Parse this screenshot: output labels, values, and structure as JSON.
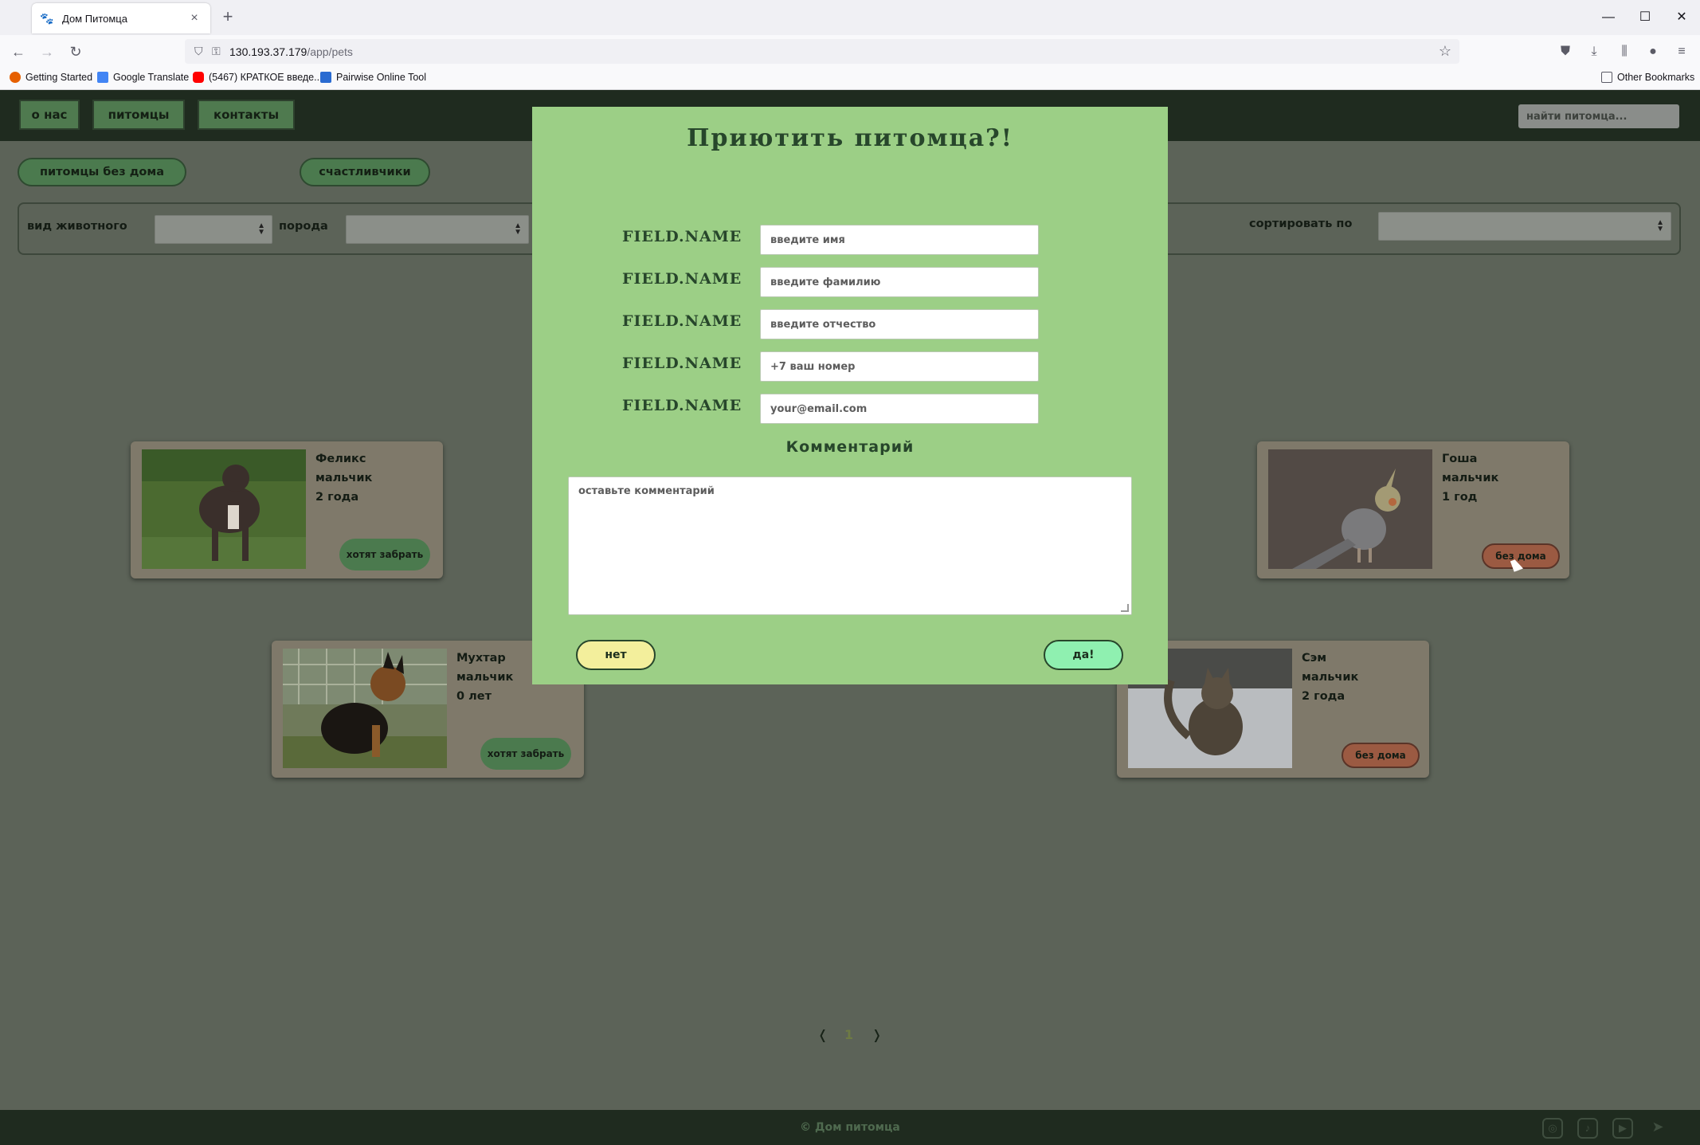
{
  "browser": {
    "tab_title": "Дом Питомца",
    "tab_close_icon": "×",
    "new_tab_icon": "+",
    "url_host": "130.193.37.179",
    "url_path": "/app/pets",
    "window_controls": {
      "minimize": "—",
      "maximize": "☐",
      "close": "✕"
    },
    "nav": {
      "back": "←",
      "forward": "→",
      "reload": "↻"
    },
    "bookmarks": [
      {
        "label": "Getting Started",
        "color": "#e66000"
      },
      {
        "label": "Google Translate",
        "color": "#4285f4"
      },
      {
        "label": "(5467) КРАТКОЕ введе...",
        "color": "#ff0000"
      },
      {
        "label": "Pairwise Online Tool",
        "color": "#2a6bd1"
      }
    ],
    "other_bookmarks": "Other Bookmarks"
  },
  "header": {
    "nav_items": [
      "о нас",
      "питомцы",
      "контакты"
    ],
    "search_placeholder": "найти питомца..."
  },
  "filters": {
    "tabs": [
      "питомцы без дома",
      "счастливчики"
    ],
    "species_label": "вид животного",
    "breed_label": "порода",
    "sort_label": "сортировать по"
  },
  "pets": [
    {
      "name": "Феликс",
      "gender": "мальчик",
      "age": "2 года",
      "status": "хотят забрать",
      "status_color": "#4b7a4e"
    },
    {
      "name": "Гоша",
      "gender": "мальчик",
      "age": "1 год",
      "status": "без дома",
      "status_color": "#9b5a42"
    },
    {
      "name": "Мухтар",
      "gender": "мальчик",
      "age": "0 лет",
      "status": "хотят забрать",
      "status_color": "#4b7a4e"
    },
    {
      "name": "Сэм",
      "gender": "мальчик",
      "age": "2 года",
      "status": "без дома",
      "status_color": "#9b5a42"
    }
  ],
  "pagination": {
    "prev": "❬",
    "current": "1",
    "next": "❭"
  },
  "footer": {
    "text": "© Дом питомца",
    "social_icons": [
      "instagram-icon",
      "tiktok-icon",
      "youtube-icon",
      "telegram-icon"
    ]
  },
  "modal": {
    "title": "Приютить питомца?!",
    "fields": [
      {
        "label": "FIELD.NAME",
        "placeholder": "введите имя"
      },
      {
        "label": "FIELD.NAME",
        "placeholder": "введите фамилию"
      },
      {
        "label": "FIELD.NAME",
        "placeholder": "введите отчество"
      },
      {
        "label": "FIELD.NAME",
        "placeholder": "+7 ваш номер"
      },
      {
        "label": "FIELD.NAME",
        "placeholder": "your@email.com"
      }
    ],
    "comment_label": "Комментарий",
    "comment_placeholder": "оставьте комментарий",
    "no_label": "нет",
    "yes_label": "да!"
  }
}
